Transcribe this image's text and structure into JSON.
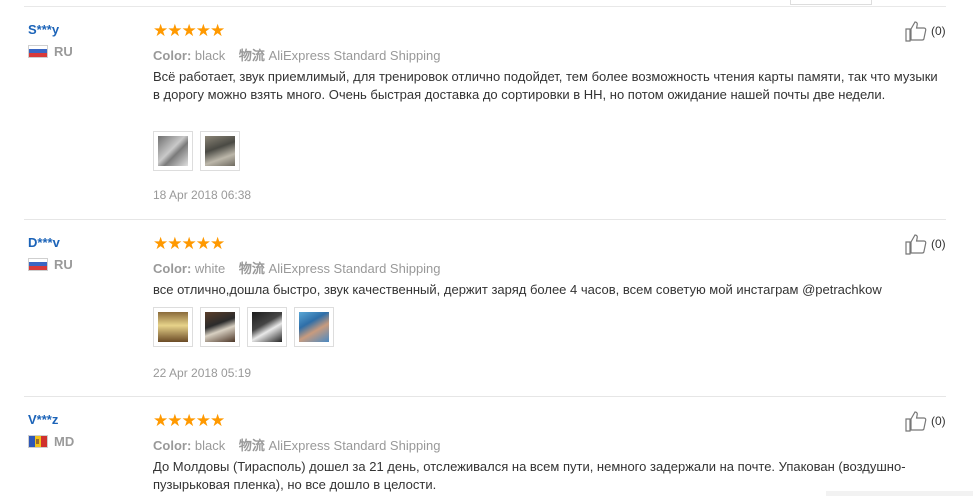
{
  "reviews": [
    {
      "user": "S***y",
      "country": "RU",
      "stars": "★★★★★",
      "color_label": "Color:",
      "color_value": "black",
      "shipping_label": "物流",
      "shipping_value": "AliExpress Standard Shipping",
      "text": "Всё работает, звук приемлимый, для тренировок отлично подойдет, тем более возможность чтения карты памяти, так что музыки в дорогу можно взять много. Очень быстрая доставка до сортировки в НН, но потом ожидание нашей почты две недели.",
      "date": "18 Apr 2018 06:38",
      "likes": "(0)",
      "photo_count": 2
    },
    {
      "user": "D***v",
      "country": "RU",
      "stars": "★★★★★",
      "color_label": "Color:",
      "color_value": "white",
      "shipping_label": "物流",
      "shipping_value": "AliExpress Standard Shipping",
      "text": "все отлично,дошла быстро, звук качественный, держит заряд более 4 часов, всем советую мой инстаграм @petrachkow",
      "date": "22 Apr 2018 05:19",
      "likes": "(0)",
      "photo_count": 4
    },
    {
      "user": "V***z",
      "country": "MD",
      "stars": "★★★★★",
      "color_label": "Color:",
      "color_value": "black",
      "shipping_label": "物流",
      "shipping_value": "AliExpress Standard Shipping",
      "text": "До Молдовы (Тирасполь) дошел за 21 день, отслеживался на всем пути, немного задержали на почте. Упакован (воздушно-пузырьковая пленка), но все дошло в целости.",
      "likes": "(0)"
    }
  ],
  "colors": {
    "star": "#ff9900",
    "username": "#1b63b8"
  },
  "icons": {
    "like": "thumbs-up-icon",
    "flag_ru": "russia-flag-icon",
    "flag_md": "moldova-flag-icon"
  }
}
